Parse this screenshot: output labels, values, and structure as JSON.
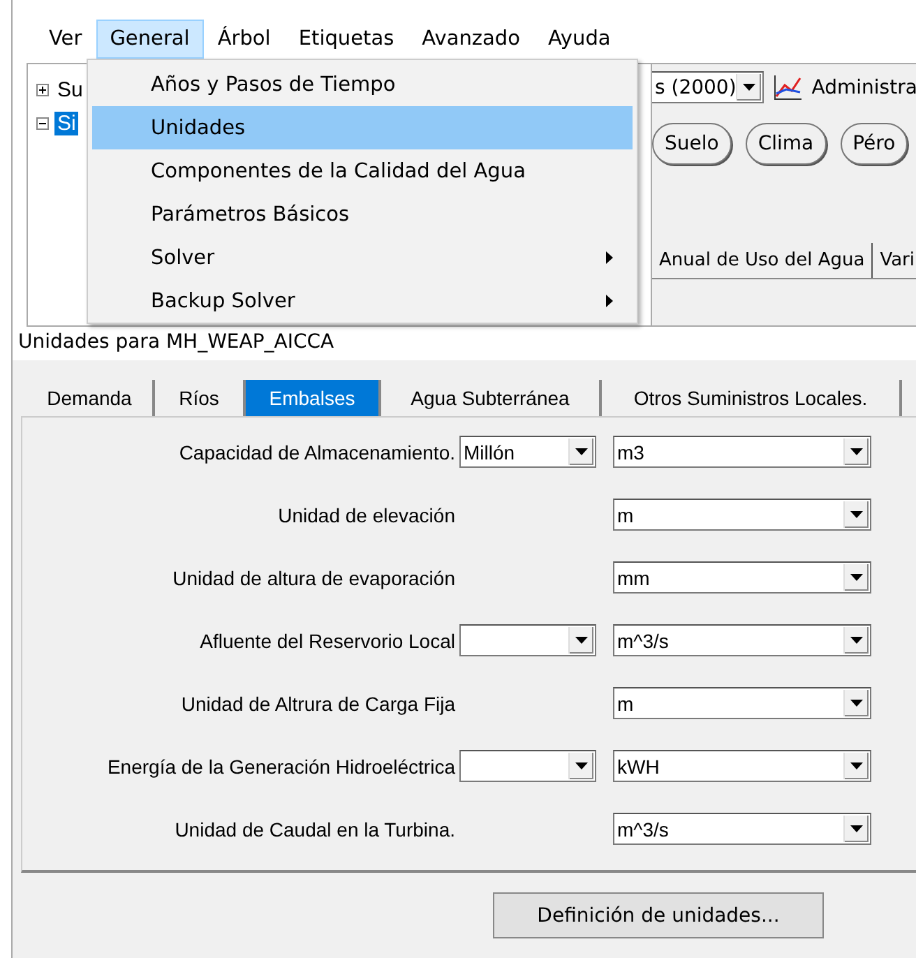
{
  "menu_bar": [
    {
      "label": "Ver",
      "selected": false
    },
    {
      "label": "General",
      "selected": true
    },
    {
      "label": "Árbol",
      "selected": false
    },
    {
      "label": "Etiquetas",
      "selected": false
    },
    {
      "label": "Avanzado",
      "selected": false
    },
    {
      "label": "Ayuda",
      "selected": false
    }
  ],
  "menu": [
    {
      "label": "Años y Pasos de Tiempo",
      "selected": false,
      "submenu": false
    },
    {
      "label": "Unidades",
      "selected": true,
      "submenu": false
    },
    {
      "label": "Componentes de la Calidad del Agua",
      "selected": false,
      "submenu": false
    },
    {
      "label": "Parámetros Básicos",
      "selected": false,
      "submenu": false
    },
    {
      "label": "Solver",
      "selected": false,
      "submenu": true
    },
    {
      "label": "Backup Solver",
      "selected": false,
      "submenu": true
    }
  ],
  "tree": [
    {
      "label": "Su",
      "expanded": false,
      "selected": false
    },
    {
      "label": "Si",
      "expanded": true,
      "selected": true
    }
  ],
  "background": {
    "scenario_value": "s (2000)",
    "manager_button": "Administra",
    "buttons": [
      "Suelo",
      "Clima",
      "Péro"
    ],
    "tabs": [
      "Anual de Uso del Agua",
      "Vari"
    ]
  },
  "dialog": {
    "title": "Unidades para MH_WEAP_AICCA",
    "tabs": [
      {
        "label": "Demanda",
        "selected": false
      },
      {
        "label": "Ríos",
        "selected": false
      },
      {
        "label": "Embalses",
        "selected": true
      },
      {
        "label": "Agua Subterránea",
        "selected": false
      },
      {
        "label": "Otros Suministros Locales.",
        "selected": false
      }
    ],
    "rows": [
      {
        "label": "Capacidad de Almacenamiento.",
        "kind": "double",
        "prefix_value": "Millón",
        "value": "m3"
      },
      {
        "label": "Unidad de elevación",
        "kind": "single",
        "value": "m"
      },
      {
        "label": "Unidad de altura de evaporación",
        "kind": "single",
        "value": "mm"
      },
      {
        "label": "Afluente del Reservorio Local",
        "kind": "double",
        "value": "m^3/s"
      },
      {
        "label": "Unidad de Altrura de Carga Fija",
        "kind": "single",
        "value": "m"
      },
      {
        "label": "Energía de la Generación Hidroeléctrica",
        "kind": "double",
        "value": "kWH"
      },
      {
        "label": "Unidad de Caudal en la Turbina.",
        "kind": "single",
        "value": "m^3/s"
      }
    ],
    "button": "Definición de unidades..."
  }
}
